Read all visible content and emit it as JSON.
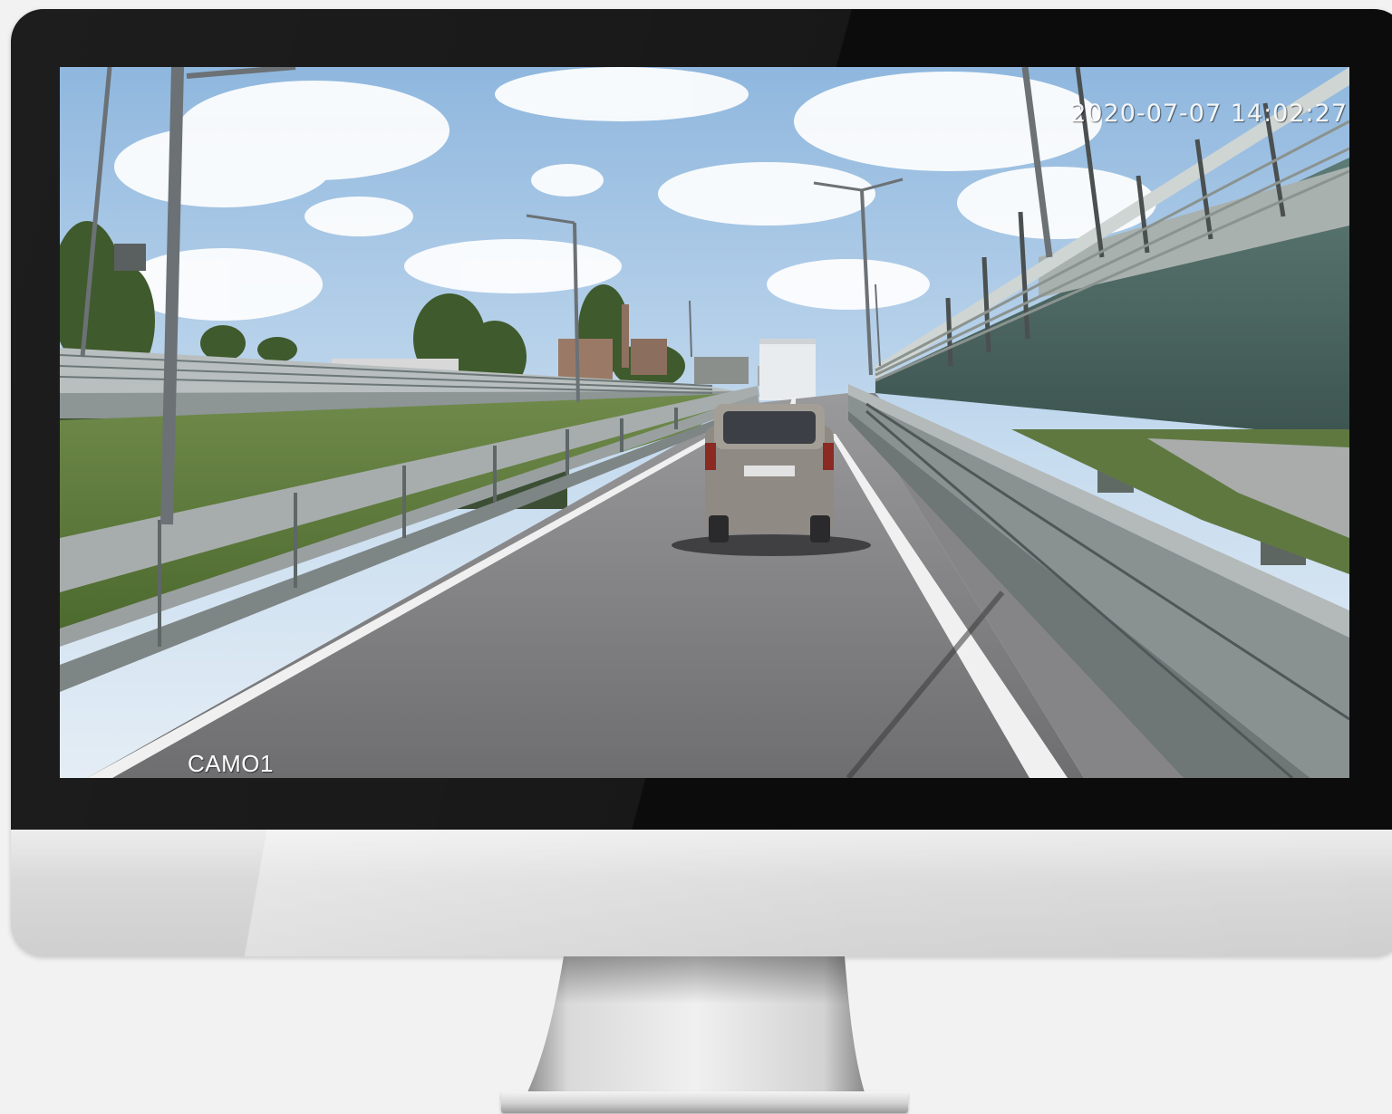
{
  "feed": {
    "timestamp": "2020-07-07 14:02:27",
    "camera_label": "CAMO1"
  },
  "colors": {
    "bezel": "#0c0c0c",
    "chin": "#dcdcdc",
    "background": "#f2f2f2",
    "sky": "#a9c9e6",
    "road": "#7b7b7d",
    "lane_marking": "#f2f2f2"
  },
  "icons": {
    "monitor": "desktop-monitor-icon"
  }
}
